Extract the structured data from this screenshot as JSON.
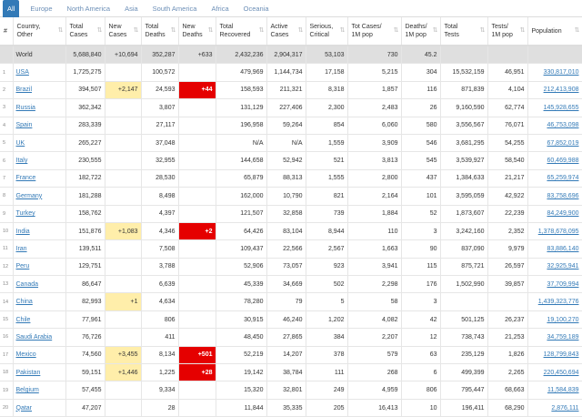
{
  "tabs": [
    "All",
    "Europe",
    "North America",
    "Asia",
    "South America",
    "Africa",
    "Oceania"
  ],
  "headers": [
    "#",
    "Country,\nOther",
    "Total\nCases",
    "New\nCases",
    "Total\nDeaths",
    "New\nDeaths",
    "Total\nRecovered",
    "Active\nCases",
    "Serious,\nCritical",
    "Tot Cases/\n1M pop",
    "Deaths/\n1M pop",
    "Total\nTests",
    "Tests/\n1M pop",
    "Population"
  ],
  "world": [
    "",
    "World",
    "5,688,840",
    "+10,694",
    "352,287",
    "+633",
    "2,432,236",
    "2,904,317",
    "53,103",
    "730",
    "45.2",
    "",
    "",
    ""
  ],
  "rows": [
    [
      "1",
      "USA",
      "1,725,275",
      "",
      "100,572",
      "",
      "479,969",
      "1,144,734",
      "17,158",
      "5,215",
      "304",
      "15,532,159",
      "46,951",
      "330,817,010"
    ],
    [
      "2",
      "Brazil",
      "394,507",
      "+2,147",
      "24,593",
      "+44",
      "158,593",
      "211,321",
      "8,318",
      "1,857",
      "116",
      "871,839",
      "4,104",
      "212,413,908"
    ],
    [
      "3",
      "Russia",
      "362,342",
      "",
      "3,807",
      "",
      "131,129",
      "227,406",
      "2,300",
      "2,483",
      "26",
      "9,160,590",
      "62,774",
      "145,928,655"
    ],
    [
      "4",
      "Spain",
      "283,339",
      "",
      "27,117",
      "",
      "196,958",
      "59,264",
      "854",
      "6,060",
      "580",
      "3,556,567",
      "76,071",
      "46,753,098"
    ],
    [
      "5",
      "UK",
      "265,227",
      "",
      "37,048",
      "",
      "N/A",
      "N/A",
      "1,559",
      "3,909",
      "546",
      "3,681,295",
      "54,255",
      "67,852,019"
    ],
    [
      "6",
      "Italy",
      "230,555",
      "",
      "32,955",
      "",
      "144,658",
      "52,942",
      "521",
      "3,813",
      "545",
      "3,539,927",
      "58,540",
      "60,469,988"
    ],
    [
      "7",
      "France",
      "182,722",
      "",
      "28,530",
      "",
      "65,879",
      "88,313",
      "1,555",
      "2,800",
      "437",
      "1,384,633",
      "21,217",
      "65,259,974"
    ],
    [
      "8",
      "Germany",
      "181,288",
      "",
      "8,498",
      "",
      "162,000",
      "10,790",
      "821",
      "2,164",
      "101",
      "3,595,059",
      "42,922",
      "83,758,696"
    ],
    [
      "9",
      "Turkey",
      "158,762",
      "",
      "4,397",
      "",
      "121,507",
      "32,858",
      "739",
      "1,884",
      "52",
      "1,873,607",
      "22,239",
      "84,249,900"
    ],
    [
      "10",
      "India",
      "151,876",
      "+1,083",
      "4,346",
      "+2",
      "64,426",
      "83,104",
      "8,944",
      "110",
      "3",
      "3,242,160",
      "2,352",
      "1,378,678,095"
    ],
    [
      "11",
      "Iran",
      "139,511",
      "",
      "7,508",
      "",
      "109,437",
      "22,566",
      "2,567",
      "1,663",
      "90",
      "837,090",
      "9,979",
      "83,886,140"
    ],
    [
      "12",
      "Peru",
      "129,751",
      "",
      "3,788",
      "",
      "52,906",
      "73,057",
      "923",
      "3,941",
      "115",
      "875,721",
      "26,597",
      "32,925,941"
    ],
    [
      "13",
      "Canada",
      "86,647",
      "",
      "6,639",
      "",
      "45,339",
      "34,669",
      "502",
      "2,298",
      "176",
      "1,502,990",
      "39,857",
      "37,709,994"
    ],
    [
      "14",
      "China",
      "82,993",
      "+1",
      "4,634",
      "",
      "78,280",
      "79",
      "5",
      "58",
      "3",
      "",
      "",
      "1,439,323,776"
    ],
    [
      "15",
      "Chile",
      "77,961",
      "",
      "806",
      "",
      "30,915",
      "46,240",
      "1,202",
      "4,082",
      "42",
      "501,125",
      "26,237",
      "19,100,270"
    ],
    [
      "16",
      "Saudi Arabia",
      "76,726",
      "",
      "411",
      "",
      "48,450",
      "27,865",
      "384",
      "2,207",
      "12",
      "738,743",
      "21,253",
      "34,759,189"
    ],
    [
      "17",
      "Mexico",
      "74,560",
      "+3,455",
      "8,134",
      "+501",
      "52,219",
      "14,207",
      "378",
      "579",
      "63",
      "235,129",
      "1,826",
      "128,799,843"
    ],
    [
      "18",
      "Pakistan",
      "59,151",
      "+1,446",
      "1,225",
      "+28",
      "19,142",
      "38,784",
      "111",
      "268",
      "6",
      "499,399",
      "2,265",
      "220,450,694"
    ],
    [
      "19",
      "Belgium",
      "57,455",
      "",
      "9,334",
      "",
      "15,320",
      "32,801",
      "249",
      "4,959",
      "806",
      "795,447",
      "68,663",
      "11,584,839"
    ],
    [
      "20",
      "Qatar",
      "47,207",
      "",
      "28",
      "",
      "11,844",
      "35,335",
      "205",
      "16,413",
      "10",
      "196,411",
      "68,290",
      "2,876,111"
    ]
  ]
}
